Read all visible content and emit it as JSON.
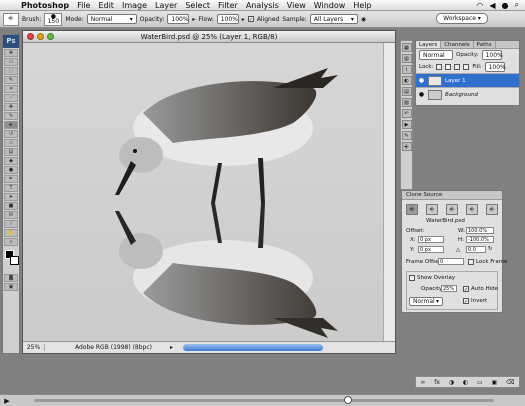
{
  "menubar": {
    "app": "Photoshop",
    "items": [
      "File",
      "Edit",
      "Image",
      "Layer",
      "Select",
      "Filter",
      "Analysis",
      "View",
      "Window",
      "Help"
    ]
  },
  "options": {
    "brush_label": "Brush:",
    "brush_size": "150",
    "mode_label": "Mode:",
    "mode_value": "Normal",
    "opacity_label": "Opacity:",
    "opacity_value": "100%",
    "flow_label": "Flow:",
    "flow_value": "100%",
    "aligned_label": "Aligned",
    "sample_label": "Sample:",
    "sample_value": "All Layers",
    "workspace_label": "Workspace"
  },
  "document": {
    "title": "WaterBird.psd @ 25% (Layer 1, RGB/8)",
    "zoom": "25%",
    "profile": "Adobe RGB (1998) (8bpc)"
  },
  "layers_panel": {
    "tabs": [
      "Layers",
      "Channels",
      "Paths"
    ],
    "blend_mode": "Normal",
    "opacity_label": "Opacity:",
    "opacity_value": "100%",
    "lock_label": "Lock:",
    "fill_label": "Fill:",
    "fill_value": "100%",
    "layers": [
      {
        "name": "Layer 1",
        "active": true
      },
      {
        "name": "Background",
        "active": false
      }
    ]
  },
  "clone_source": {
    "title": "Clone Source",
    "source_file": "WaterBird.psd",
    "offset_label": "Offset:",
    "x_label": "X:",
    "x_value": "0 px",
    "y_label": "Y:",
    "y_value": "0 px",
    "w_label": "W:",
    "w_value": "100.0%",
    "h_label": "H:",
    "h_value": "-100.0%",
    "angle_value": "0.0",
    "frame_offset_label": "Frame Offset:",
    "frame_offset_value": "0",
    "lock_frame_label": "Lock Frame",
    "show_overlay_label": "Show Overlay",
    "opacity_label": "Opacity:",
    "opacity_value": "25%",
    "auto_hide_label": "Auto Hide",
    "mode_value": "Normal",
    "invert_label": "Invert"
  },
  "colors": {
    "accent": "#2f6fce",
    "canvas_bg": "#d3d3d3"
  }
}
